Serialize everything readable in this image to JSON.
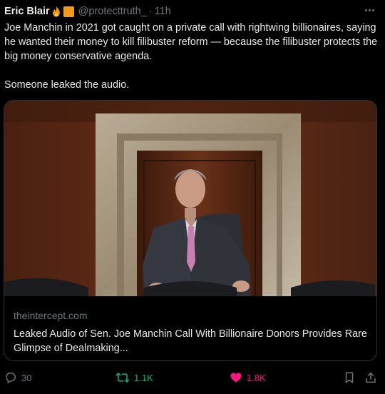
{
  "tweet": {
    "author_name": "Eric Blair",
    "author_badges": [
      "fire-emoji",
      "orange-square-emoji"
    ],
    "handle": "@protecttruth_",
    "separator": "·",
    "time": "11h",
    "more_icon": "more-icon",
    "paragraphs": [
      "Joe Manchin in 2021 got caught on a private call with rightwing billionaires, saying he wanted their money to kill filibuster reform — because the filibuster protects the big money conservative agenda.",
      "Someone leaked the audio."
    ]
  },
  "card": {
    "domain": "theintercept.com",
    "title": "Leaked Audio of Sen. Joe Manchin Call With Billionaire Donors Provides Rare Glimpse of Dealmaking..."
  },
  "actions": {
    "replies": "30",
    "retweets": "1.1K",
    "likes": "1.8K",
    "icons": [
      "reply-icon",
      "retweet-icon",
      "like-icon",
      "bookmark-icon",
      "share-icon"
    ]
  },
  "colors": {
    "background": "#000000",
    "text": "#e7e9ea",
    "muted": "#71767b",
    "retweet": "#00ba7c",
    "like": "#f91880",
    "badge_orange": "#f59a1b"
  }
}
